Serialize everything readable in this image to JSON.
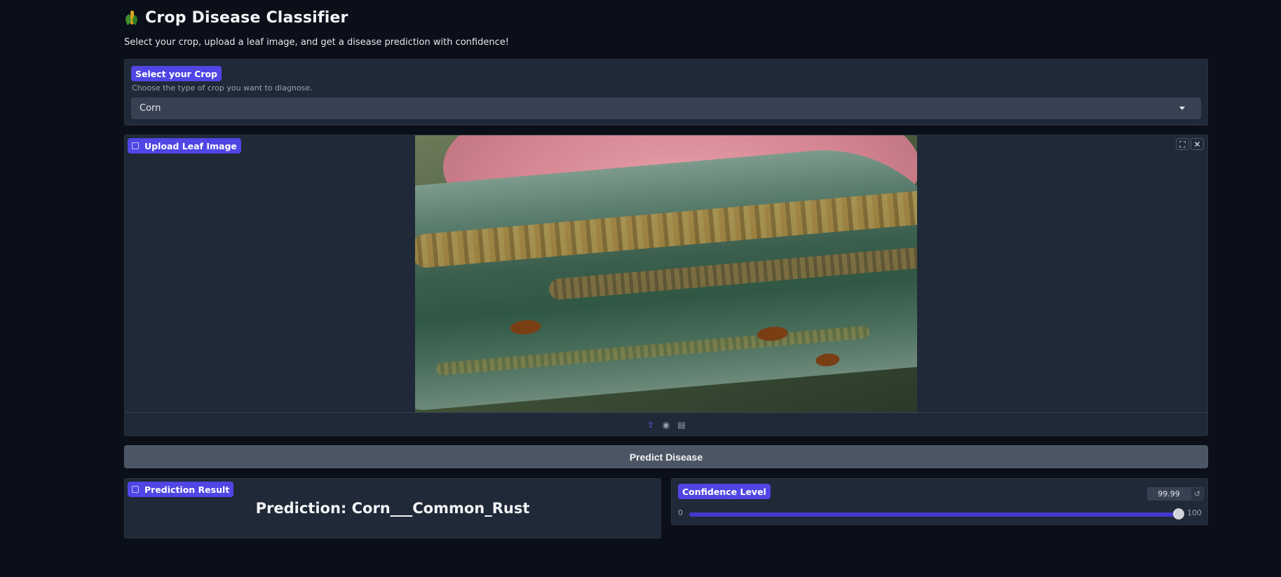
{
  "header": {
    "title": "Crop Disease Classifier",
    "icon": "corn-emoji-icon"
  },
  "subtitle": "Select your crop, upload a leaf image, and get a disease prediction with confidence!",
  "crop_select": {
    "label": "Select your Crop",
    "info": "Choose the type of crop you want to diagnose.",
    "value": "Corn"
  },
  "upload": {
    "label": "Upload Leaf Image",
    "icons": [
      "image-icon",
      "fullscreen-icon",
      "close-icon",
      "upload-icon",
      "webcam-icon",
      "clipboard-icon"
    ]
  },
  "predict_button": {
    "label": "Predict Disease"
  },
  "result": {
    "label": "Prediction Result",
    "text": "Prediction: Corn___Common_Rust"
  },
  "confidence": {
    "label": "Confidence Level",
    "value": "99.99",
    "min": "0",
    "max": "100",
    "fraction": 0.9999
  },
  "colors": {
    "background": "#0b0f19",
    "panel": "#1f2937",
    "accent": "#4f46e5",
    "button": "#4b5563"
  }
}
